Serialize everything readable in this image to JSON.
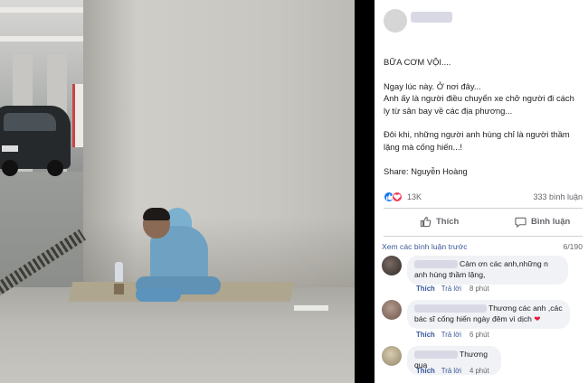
{
  "post": {
    "title": "BỮA CƠM VỘI....",
    "lines": [
      "Ngay lúc này. Ở nơi đây...",
      "Anh ấy là người điều chuyển xe chở người đi cách ly từ sân bay về các địa phương...",
      "Đôi khi, những người anh hùng chỉ là người thầm lặng mà cống hiến...!",
      "Share: Nguyễn Hoàng"
    ]
  },
  "stats": {
    "reactions": "13K",
    "comments": "333 bình luận"
  },
  "actions": {
    "like": "Thích",
    "comment": "Bình luận"
  },
  "comments_header": {
    "view_previous": "Xem các bình luận trước",
    "count": "6/190"
  },
  "comments": [
    {
      "text": "Cảm ơn các anh,những n anh hùng thầm lặng,",
      "like": "Thích",
      "reply": "Trả lời",
      "time": "8 phút"
    },
    {
      "text": "Thương các anh ,các bác sĩ cống hiến ngày đêm vì dịch",
      "emoji": "❤",
      "like": "Thích",
      "reply": "Trả lời",
      "time": "6 phút"
    },
    {
      "text": "Thương qua",
      "like": "Thích",
      "reply": "Trả lời",
      "time": "4 phút"
    }
  ],
  "colors": {
    "link": "#385898",
    "like_blue": "#1877f2",
    "love_red": "#f33e58",
    "bubble": "#f0f2f5"
  },
  "icons": [
    "like-icon",
    "comment-icon",
    "heart-icon"
  ]
}
